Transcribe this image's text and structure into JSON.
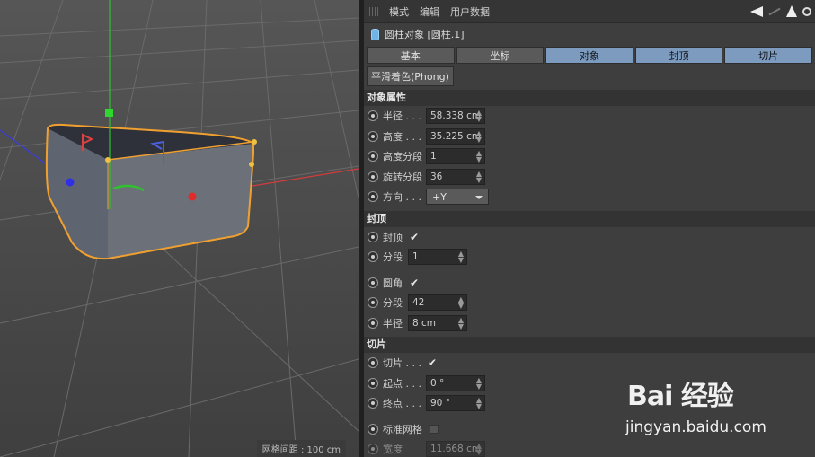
{
  "viewport": {
    "grid_label": "网格间距 : 100 cm"
  },
  "menu": {
    "items": [
      "模式",
      "编辑",
      "用户数据"
    ]
  },
  "object": {
    "title": "圆柱对象 [圆柱.1]"
  },
  "tabs": [
    {
      "label": "基本",
      "active": false
    },
    {
      "label": "坐标",
      "active": false
    },
    {
      "label": "对象",
      "active": true
    },
    {
      "label": "封顶",
      "active": true
    },
    {
      "label": "切片",
      "active": true
    }
  ],
  "phong_button": "平滑着色(Phong)",
  "object_props": {
    "heading": "对象属性",
    "radius": {
      "label": "半径 . . .",
      "value": "58.338 cm"
    },
    "height": {
      "label": "高度 . . .",
      "value": "35.225 cm"
    },
    "height_seg": {
      "label": "高度分段",
      "value": "1"
    },
    "rot_seg": {
      "label": "旋转分段",
      "value": "36"
    },
    "orientation": {
      "label": "方向 . . .",
      "value": "+Y"
    }
  },
  "caps": {
    "heading": "封顶",
    "cap": {
      "label": "封顶",
      "checked": true
    },
    "cap_seg": {
      "label": "分段",
      "value": "1"
    },
    "fillet": {
      "label": "圆角",
      "checked": true
    },
    "fillet_seg": {
      "label": "分段",
      "value": "42"
    },
    "fillet_radius": {
      "label": "半径",
      "value": "8 cm"
    }
  },
  "slice": {
    "heading": "切片",
    "slice": {
      "label": "切片 . . .",
      "checked": true
    },
    "from": {
      "label": "起点 . . .",
      "value": "0 °"
    },
    "to": {
      "label": "终点 . . .",
      "value": "90 °"
    },
    "regular_grid": {
      "label": "标准网格",
      "checked": false
    },
    "width": {
      "label": "宽度",
      "value": "11.668 cm"
    }
  },
  "watermark": {
    "brand": "Bai 经验",
    "site": "jingyan.baidu.com"
  },
  "colors": {
    "tab_active": "#7d9bbf",
    "selection": "#f0a030",
    "axis_x": "#d23c3c",
    "axis_y": "#2ec02e",
    "axis_z": "#3a3ae0"
  }
}
